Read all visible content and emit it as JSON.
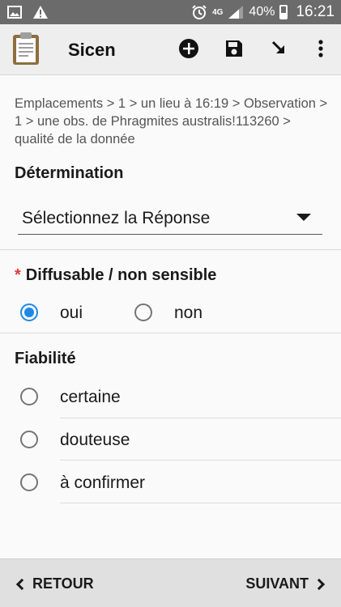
{
  "status_bar": {
    "network": "4G",
    "battery": "40%",
    "time": "16:21",
    "icons": [
      "image-icon",
      "warning-icon",
      "alarm-icon",
      "signal-icon",
      "battery-icon"
    ]
  },
  "app_bar": {
    "title": "Sicen",
    "actions": [
      "add-icon",
      "save-icon",
      "arrow-down-right-icon",
      "overflow-menu-icon"
    ]
  },
  "breadcrumb": "Emplacements > 1 > un lieu à 16:19 > Observation > 1 > une obs. de Phragmites australis!113260 > qualité de la donnée",
  "determination": {
    "label": "Détermination",
    "selected": "Sélectionnez la Réponse"
  },
  "diffusable": {
    "required_mark": "*",
    "label": "Diffusable / non sensible",
    "options": [
      {
        "label": "oui",
        "checked": true
      },
      {
        "label": "non",
        "checked": false
      }
    ]
  },
  "fiabilite": {
    "label": "Fiabilité",
    "options": [
      {
        "label": "certaine",
        "checked": false
      },
      {
        "label": "douteuse",
        "checked": false
      },
      {
        "label": "à confirmer",
        "checked": false
      }
    ]
  },
  "bottom_nav": {
    "back": "RETOUR",
    "next": "SUIVANT"
  }
}
